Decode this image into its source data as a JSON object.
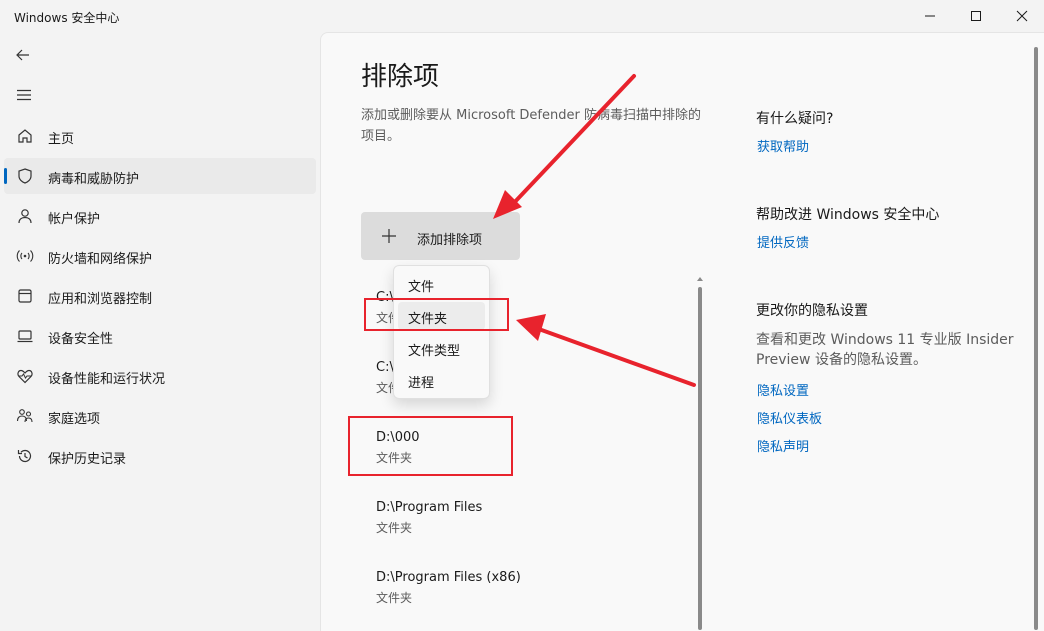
{
  "window": {
    "title": "Windows 安全中心"
  },
  "sidebar": {
    "items": [
      {
        "label": "主页",
        "icon": "home-icon"
      },
      {
        "label": "病毒和威胁防护",
        "icon": "shield-icon"
      },
      {
        "label": "帐户保护",
        "icon": "person-icon"
      },
      {
        "label": "防火墙和网络保护",
        "icon": "wifi-antenna-icon"
      },
      {
        "label": "应用和浏览器控制",
        "icon": "app-window-icon"
      },
      {
        "label": "设备安全性",
        "icon": "laptop-icon"
      },
      {
        "label": "设备性能和运行状况",
        "icon": "heart-pulse-icon"
      },
      {
        "label": "家庭选项",
        "icon": "family-icon"
      },
      {
        "label": "保护历史记录",
        "icon": "history-icon"
      }
    ],
    "selected_index": 1
  },
  "main": {
    "title": "排除项",
    "description": "添加或删除要从 Microsoft Defender 防病毒扫描中排除的项目。",
    "add_button_label": "添加排除项",
    "dropdown": [
      "文件",
      "文件夹",
      "文件类型",
      "进程"
    ],
    "exclusions": [
      {
        "path": "C:\\",
        "type": "文件夹"
      },
      {
        "path": "C:\\Game",
        "type": "文件夹"
      },
      {
        "path": "D:\\000",
        "type": "文件夹"
      },
      {
        "path": "D:\\Program Files",
        "type": "文件夹"
      },
      {
        "path": "D:\\Program Files (x86)",
        "type": "文件夹"
      }
    ]
  },
  "side": {
    "help_title": "有什么疑问?",
    "help_link": "获取帮助",
    "improve_title": "帮助改进 Windows 安全中心",
    "feedback_link": "提供反馈",
    "privacy_title": "更改你的隐私设置",
    "privacy_text": "查看和更改 Windows 11 专业版 Insider Preview 设备的隐私设置。",
    "privacy_links": [
      "隐私设置",
      "隐私仪表板",
      "隐私声明"
    ]
  },
  "colors": {
    "accent": "#0067c0",
    "annotation": "#e8232d"
  }
}
